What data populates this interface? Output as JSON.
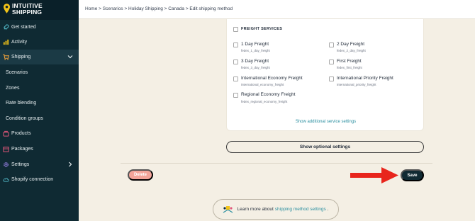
{
  "brand": {
    "line1": "INTUITIVE",
    "line2": "SHIPPING"
  },
  "sidebar": {
    "items": [
      {
        "label": "Get started",
        "icon": "rocket-icon"
      },
      {
        "label": "Activity",
        "icon": "activity-icon"
      },
      {
        "label": "Shipping",
        "icon": "cart-icon",
        "expanded": true
      },
      {
        "label": "Scenarios"
      },
      {
        "label": "Zones"
      },
      {
        "label": "Rate blending"
      },
      {
        "label": "Condition groups"
      },
      {
        "label": "Products",
        "icon": "products-icon"
      },
      {
        "label": "Packages",
        "icon": "package-icon"
      },
      {
        "label": "Settings",
        "icon": "gear-icon"
      },
      {
        "label": "Shopify connection",
        "icon": "cloud-icon"
      }
    ]
  },
  "breadcrumb": "Home > Scenarios > Holiday Shipping > Canada > Edit shipping method",
  "freight": {
    "title": "FREIGHT SERVICES",
    "services": [
      {
        "label": "1 Day Freight",
        "code": "fedex_1_day_freight",
        "checked": false
      },
      {
        "label": "2 Day Freight",
        "code": "fedex_2_day_freight",
        "checked": false
      },
      {
        "label": "3 Day Freight",
        "code": "fedex_3_day_freight",
        "checked": false
      },
      {
        "label": "First Freight",
        "code": "fedex_first_freight",
        "checked": false
      },
      {
        "label": "International Economy Freight",
        "code": "international_economy_freight",
        "checked": false
      },
      {
        "label": "International Priority Freight",
        "code": "international_priority_freight",
        "checked": false
      },
      {
        "label": "Regional Economy Freight",
        "code": "fedex_regional_economy_freight",
        "checked": false
      }
    ],
    "additional_link": "Show additional service settings"
  },
  "optional_button": "Show optional settings",
  "actions": {
    "delete": "Delete",
    "save": "Save"
  },
  "learn": {
    "prefix": "Learn more about",
    "link": "shipping method settings",
    "suffix": "."
  },
  "colors": {
    "sidebar": "#0f2a33",
    "accent": "#2a8fa0",
    "save": "#102a33",
    "delete": "#f3a49a",
    "arrow": "#e8251c",
    "background": "#f4efe4"
  }
}
